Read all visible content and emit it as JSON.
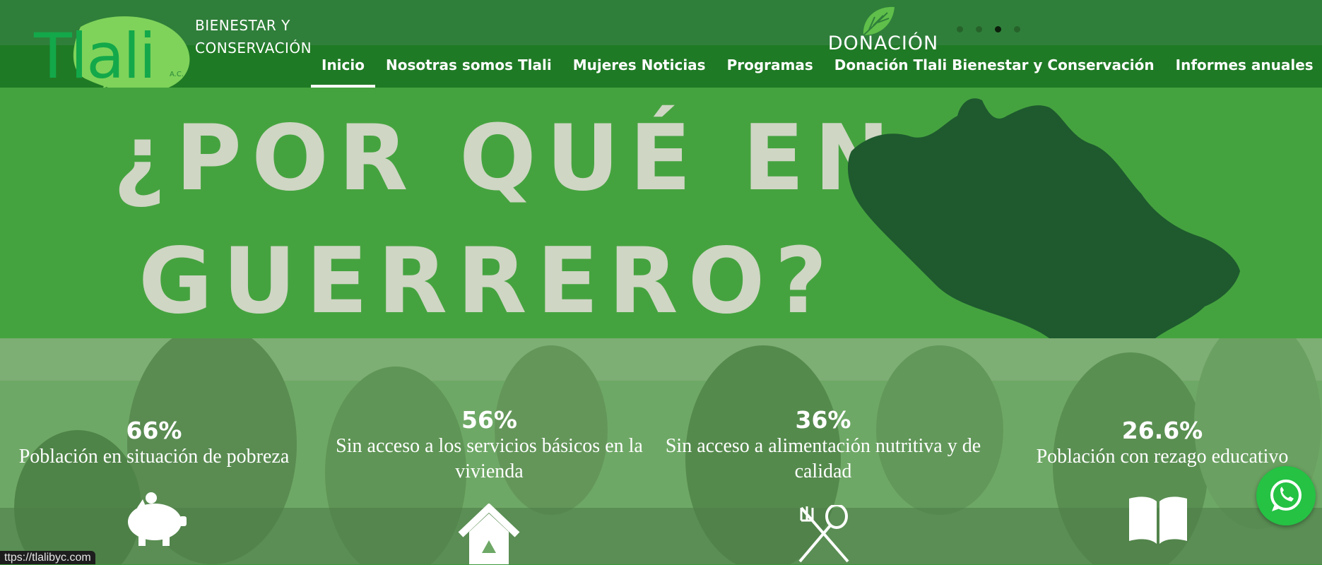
{
  "brand": {
    "logo_text": "Tlali",
    "logo_small": "A.C.",
    "tagline": "BIENESTAR Y\nCONSERVACIÓN"
  },
  "header": {
    "donacion_label": "DONACIÓN",
    "slider_dots": 4,
    "slider_active": 3
  },
  "nav": {
    "items": [
      {
        "label": "Inicio",
        "active": true
      },
      {
        "label": "Nosotras somos Tlali"
      },
      {
        "label": "Mujeres Noticias"
      },
      {
        "label": "Programas"
      },
      {
        "label": "Donación Tlali Bienestar y Conservación"
      },
      {
        "label": "Informes anuales"
      }
    ]
  },
  "hero": {
    "line1": "¿POR QUÉ EN",
    "line2": "GUERRERO?"
  },
  "stats": [
    {
      "value": "66%",
      "label": "Población en situación de pobreza",
      "icon": "piggy-bank-icon"
    },
    {
      "value": "56%",
      "label": "Sin acceso a los servicios básicos en la vivienda",
      "icon": "house-icon"
    },
    {
      "value": "36%",
      "label": "Sin acceso a alimentación nutritiva y de calidad",
      "icon": "fork-spoon-icon"
    },
    {
      "value": "26.6%",
      "label": "Población con rezago educativo",
      "icon": "book-icon"
    }
  ],
  "status_url": "ttps://tlalibyc.com",
  "colors": {
    "header_top": "#2f7f3a",
    "nav_bar": "#1f7a25",
    "hero_bg": "#45a33f",
    "hero_text": "#cfd6c4",
    "map": "#1e5a2e",
    "whatsapp": "#25c244"
  }
}
